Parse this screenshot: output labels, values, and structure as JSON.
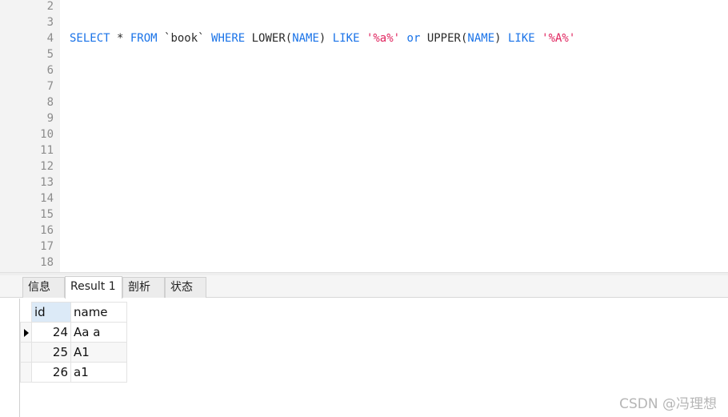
{
  "editor": {
    "lines": [
      {
        "n": "2",
        "tokens": []
      },
      {
        "n": "3",
        "tokens": []
      },
      {
        "n": "4",
        "tokens": [
          {
            "t": "SELECT",
            "c": "kw"
          },
          {
            "t": " * ",
            "c": "plain"
          },
          {
            "t": "FROM",
            "c": "kw"
          },
          {
            "t": " `book` ",
            "c": "plain"
          },
          {
            "t": "WHERE",
            "c": "kw"
          },
          {
            "t": " LOWER(",
            "c": "fn"
          },
          {
            "t": "NAME",
            "c": "col"
          },
          {
            "t": ") ",
            "c": "plain"
          },
          {
            "t": "LIKE",
            "c": "kw"
          },
          {
            "t": " ",
            "c": "plain"
          },
          {
            "t": "'%a%'",
            "c": "str"
          },
          {
            "t": " ",
            "c": "plain"
          },
          {
            "t": "or",
            "c": "kw"
          },
          {
            "t": " UPPER(",
            "c": "fn"
          },
          {
            "t": "NAME",
            "c": "col"
          },
          {
            "t": ") ",
            "c": "plain"
          },
          {
            "t": "LIKE",
            "c": "kw"
          },
          {
            "t": " ",
            "c": "plain"
          },
          {
            "t": "'%A%'",
            "c": "str"
          }
        ]
      },
      {
        "n": "5",
        "tokens": []
      },
      {
        "n": "6",
        "tokens": []
      },
      {
        "n": "7",
        "tokens": []
      },
      {
        "n": "8",
        "tokens": []
      },
      {
        "n": "9",
        "tokens": []
      },
      {
        "n": "10",
        "tokens": []
      },
      {
        "n": "11",
        "tokens": []
      },
      {
        "n": "12",
        "tokens": []
      },
      {
        "n": "13",
        "tokens": []
      },
      {
        "n": "14",
        "tokens": []
      },
      {
        "n": "15",
        "tokens": []
      },
      {
        "n": "16",
        "tokens": []
      },
      {
        "n": "17",
        "tokens": []
      },
      {
        "n": "18",
        "tokens": []
      }
    ]
  },
  "tabs": {
    "info": "信息",
    "result": "Result 1",
    "profile": "剖析",
    "status": "状态"
  },
  "result": {
    "columns": [
      "id",
      "name"
    ],
    "rows": [
      {
        "id": "24",
        "name": "Aa a",
        "current": true
      },
      {
        "id": "25",
        "name": "A1",
        "current": false
      },
      {
        "id": "26",
        "name": "a1",
        "current": false
      }
    ]
  },
  "watermark": "CSDN @冯理想",
  "colors": {
    "keyword": "#1a73e8",
    "string": "#e0245e",
    "line_number": "#8c8c8c",
    "header_highlight": "#dceaf7"
  }
}
